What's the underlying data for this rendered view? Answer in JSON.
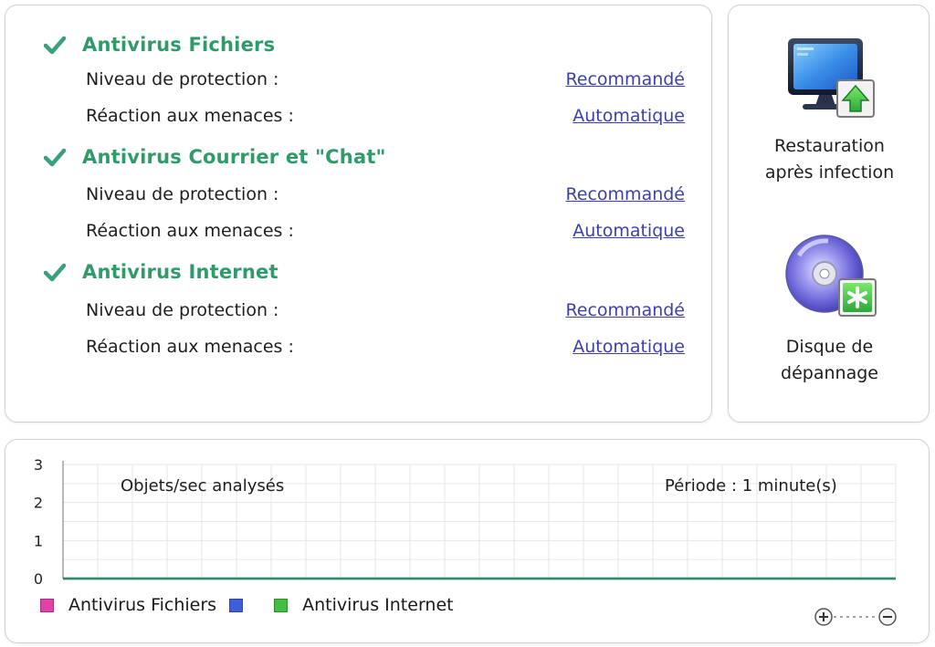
{
  "settings": {
    "sections": [
      {
        "title": "Antivirus Fichiers",
        "rows": [
          {
            "label": "Niveau de protection :",
            "value": "Recommandé"
          },
          {
            "label": "Réaction aux menaces :",
            "value": "Automatique"
          }
        ]
      },
      {
        "title": "Antivirus Courrier et \"Chat\"",
        "rows": [
          {
            "label": "Niveau de protection :",
            "value": "Recommandé"
          },
          {
            "label": "Réaction aux menaces :",
            "value": "Automatique"
          }
        ]
      },
      {
        "title": "Antivirus Internet",
        "rows": [
          {
            "label": "Niveau de protection :",
            "value": "Recommandé"
          },
          {
            "label": "Réaction aux menaces :",
            "value": "Automatique"
          }
        ]
      }
    ]
  },
  "tools": {
    "restore": {
      "line1": "Restauration",
      "line2": "après infection",
      "icon": "monitor-restore-icon"
    },
    "rescue": {
      "line1": "Disque de",
      "line2": "dépannage",
      "icon": "rescue-disk-icon"
    }
  },
  "monitor": {
    "caption": "Objets/sec analysés",
    "period": "Période : 1 minute(s)",
    "legend": [
      {
        "name": "Antivirus Fichiers",
        "color": "#e040a8"
      },
      {
        "name": "",
        "color": "#3f5fd8"
      },
      {
        "name": "Antivirus Internet",
        "color": "#40c040"
      }
    ]
  },
  "colors": {
    "section_title": "#2f9a6a",
    "link": "#3d3fb1",
    "check": "#3aa07a",
    "series_line": "#2e8a6a"
  },
  "chart_data": {
    "type": "line",
    "title": "Objets/sec analysés",
    "ylim": [
      0,
      3
    ],
    "y_ticks": [
      "0",
      "1",
      "2",
      "3"
    ],
    "grid": true,
    "series": [
      {
        "name": "Antivirus Fichiers",
        "values": [
          0,
          0,
          0,
          0,
          0,
          0,
          0,
          0,
          0,
          0,
          0,
          0,
          0,
          0,
          0,
          0,
          0,
          0,
          0,
          0,
          0,
          0,
          0,
          0,
          0,
          0,
          0,
          0,
          0,
          0,
          0,
          0,
          0,
          0,
          0,
          0,
          0,
          0,
          0,
          0,
          0,
          0,
          0,
          0,
          0,
          0,
          0,
          0,
          0,
          0,
          0,
          0,
          0,
          0,
          0,
          0,
          0,
          0,
          0,
          0
        ]
      },
      {
        "name": "Antivirus Internet",
        "values": [
          0,
          0,
          0,
          0,
          0,
          0,
          0,
          0,
          0,
          0,
          0,
          0,
          0,
          0,
          0,
          0,
          0,
          0,
          0,
          0,
          0,
          0,
          0,
          0,
          0,
          0,
          0,
          0,
          0,
          0,
          0,
          0,
          0,
          0,
          0,
          0,
          0,
          0,
          0,
          0,
          0,
          0,
          0,
          0,
          0,
          0,
          0,
          0,
          0,
          0,
          0,
          0,
          0,
          0,
          0,
          0,
          0,
          0,
          0,
          0
        ]
      }
    ]
  }
}
